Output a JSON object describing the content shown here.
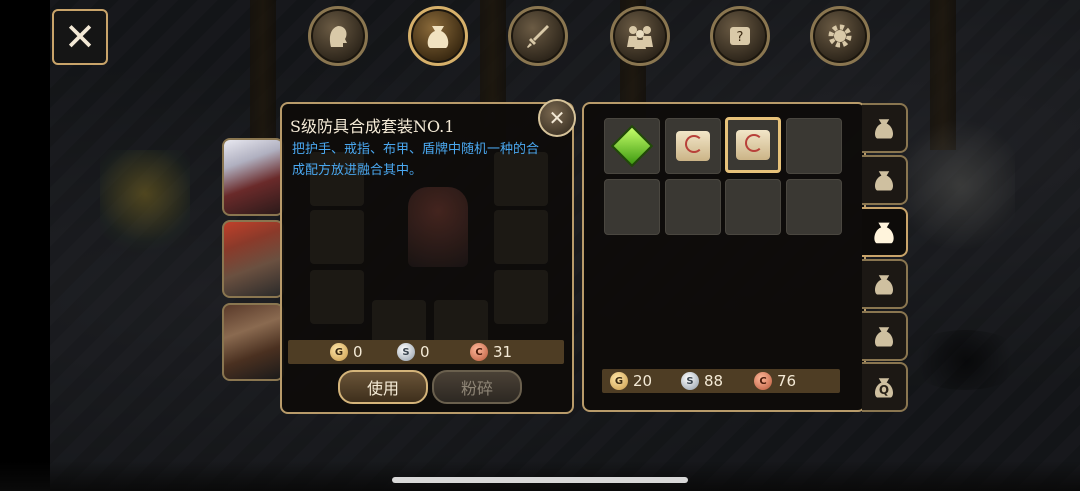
{
  "close_button": {
    "icon": "close-icon"
  },
  "top_menu": [
    {
      "name": "character",
      "icon": "head-icon",
      "active": false
    },
    {
      "name": "bag",
      "icon": "bag-icon",
      "active": true
    },
    {
      "name": "skill",
      "icon": "sword-icon",
      "active": false
    },
    {
      "name": "party",
      "icon": "party-icon",
      "active": false
    },
    {
      "name": "quest",
      "icon": "scroll-icon",
      "active": false
    },
    {
      "name": "settings",
      "icon": "gear-icon",
      "active": false
    }
  ],
  "item_detail": {
    "title": "S级防具合成套装NO.1",
    "description": "把护手、戒指、布甲、盾牌中随机一种的合成配方放进融合其中。",
    "cost": {
      "gold": "0",
      "silver": "0",
      "copper": "31"
    },
    "use_label": "使用",
    "smash_label": "粉碎"
  },
  "inventory": {
    "slots": [
      {
        "item": "green-gem"
      },
      {
        "item": "recipe-scroll"
      },
      {
        "item": "recipe-scroll",
        "selected": true
      },
      {
        "item": ""
      },
      {
        "item": ""
      },
      {
        "item": ""
      },
      {
        "item": ""
      },
      {
        "item": ""
      }
    ],
    "currency": {
      "gold": "20",
      "silver": "88",
      "copper": "76"
    }
  },
  "bag_tabs": [
    {
      "icon": "bag-icon",
      "label": "",
      "active": false
    },
    {
      "icon": "bag-icon",
      "label": "",
      "active": false
    },
    {
      "icon": "bag-icon",
      "label": "",
      "active": true
    },
    {
      "icon": "bag-icon",
      "label": "",
      "active": false
    },
    {
      "icon": "bag-icon",
      "label": "",
      "active": false
    },
    {
      "icon": "bag-icon",
      "label": "Q",
      "active": false
    }
  ],
  "coin_letters": {
    "gold": "G",
    "silver": "S",
    "copper": "C"
  },
  "colors": {
    "panel_border": "#b89b6a",
    "description_text": "#4aa8f0",
    "currency_bar": "#4e3d24",
    "selected_slot": "#e7c27a"
  }
}
